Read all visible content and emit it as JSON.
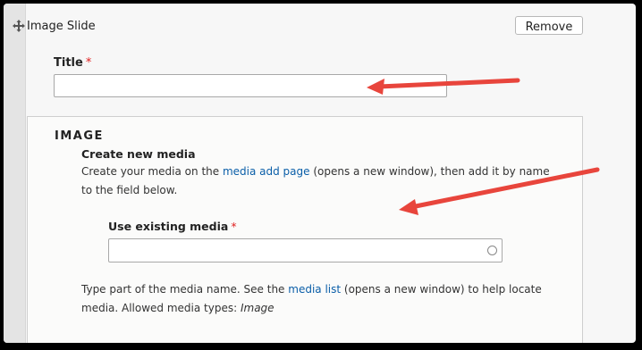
{
  "slide": {
    "title": "Image Slide",
    "remove_label": "Remove",
    "drag_icon": "move-icon"
  },
  "title_field": {
    "label": "Title",
    "required_mark": "*",
    "value": ""
  },
  "image_panel": {
    "heading": "IMAGE",
    "create_heading": "Create new media",
    "desc_before": "Create your media on the ",
    "desc_link": "media add page",
    "desc_after_1": " (opens a new window), then add it by name",
    "desc_after_2": "to the field below.",
    "existing_label": "Use existing media",
    "existing_required": "*",
    "existing_value": "",
    "help_before": "Type part of the media name. See the ",
    "help_link": "media list",
    "help_after": " (opens a new window) to help locate",
    "help_line2": "media. Allowed media types: ",
    "help_types": "Image"
  },
  "annotations": {
    "arrow_color": "#e8453c"
  }
}
